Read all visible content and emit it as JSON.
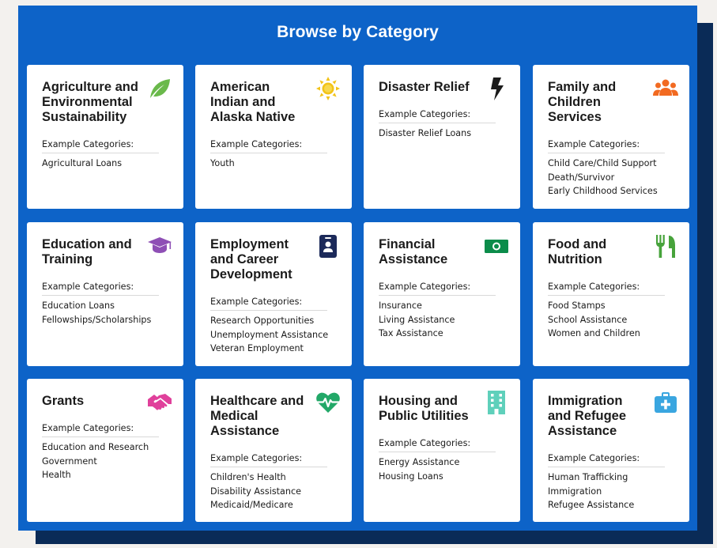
{
  "header": {
    "title": "Browse by Category"
  },
  "example_label": "Example Categories:",
  "cards": [
    {
      "title": "Agriculture and Environmental Sustainability",
      "icon": "leaf-icon",
      "color": "#6ab94b",
      "items": [
        "Agricultural Loans"
      ]
    },
    {
      "title": "American Indian and Alaska Native",
      "icon": "sun-icon",
      "color": "#f2c318",
      "items": [
        "Youth"
      ]
    },
    {
      "title": "Disaster Relief",
      "icon": "lightning-bolt-icon",
      "color": "#1b1b1b",
      "items": [
        "Disaster Relief Loans"
      ]
    },
    {
      "title": "Family and Children Services",
      "icon": "people-group-icon",
      "color": "#f26a21",
      "items": [
        "Child Care/Child Support",
        "Death/Survivor",
        "Early Childhood Services"
      ]
    },
    {
      "title": "Education and Training",
      "icon": "graduation-cap-icon",
      "color": "#8e4fb5",
      "items": [
        "Education Loans",
        "Fellowships/Scholarships"
      ]
    },
    {
      "title": "Employment and Career Development",
      "icon": "id-badge-icon",
      "color": "#1c2a5a",
      "items": [
        "Research Opportunities",
        "Unemployment Assistance",
        "Veteran Employment"
      ]
    },
    {
      "title": "Financial Assistance",
      "icon": "money-bill-icon",
      "color": "#0b8c4a",
      "items": [
        "Insurance",
        "Living Assistance",
        "Tax Assistance"
      ]
    },
    {
      "title": "Food and Nutrition",
      "icon": "fork-knife-icon",
      "color": "#47a33b",
      "items": [
        "Food Stamps",
        "School Assistance",
        "Women and Children"
      ]
    },
    {
      "title": "Grants",
      "icon": "handshake-icon",
      "color": "#e0409b",
      "items": [
        "Education and Research",
        "Government",
        "Health"
      ]
    },
    {
      "title": "Healthcare and Medical Assistance",
      "icon": "heartbeat-icon",
      "color": "#22a868",
      "items": [
        "Children's Health",
        "Disability Assistance",
        "Medicaid/Medicare"
      ]
    },
    {
      "title": "Housing and Public Utilities",
      "icon": "building-icon",
      "color": "#5fd0bb",
      "items": [
        "Energy Assistance",
        "Housing Loans"
      ]
    },
    {
      "title": "Immigration and Refugee Assistance",
      "icon": "medical-kit-icon",
      "color": "#3aa6e0",
      "items": [
        "Human Trafficking",
        "Immigration",
        "Refugee Assistance"
      ]
    }
  ]
}
